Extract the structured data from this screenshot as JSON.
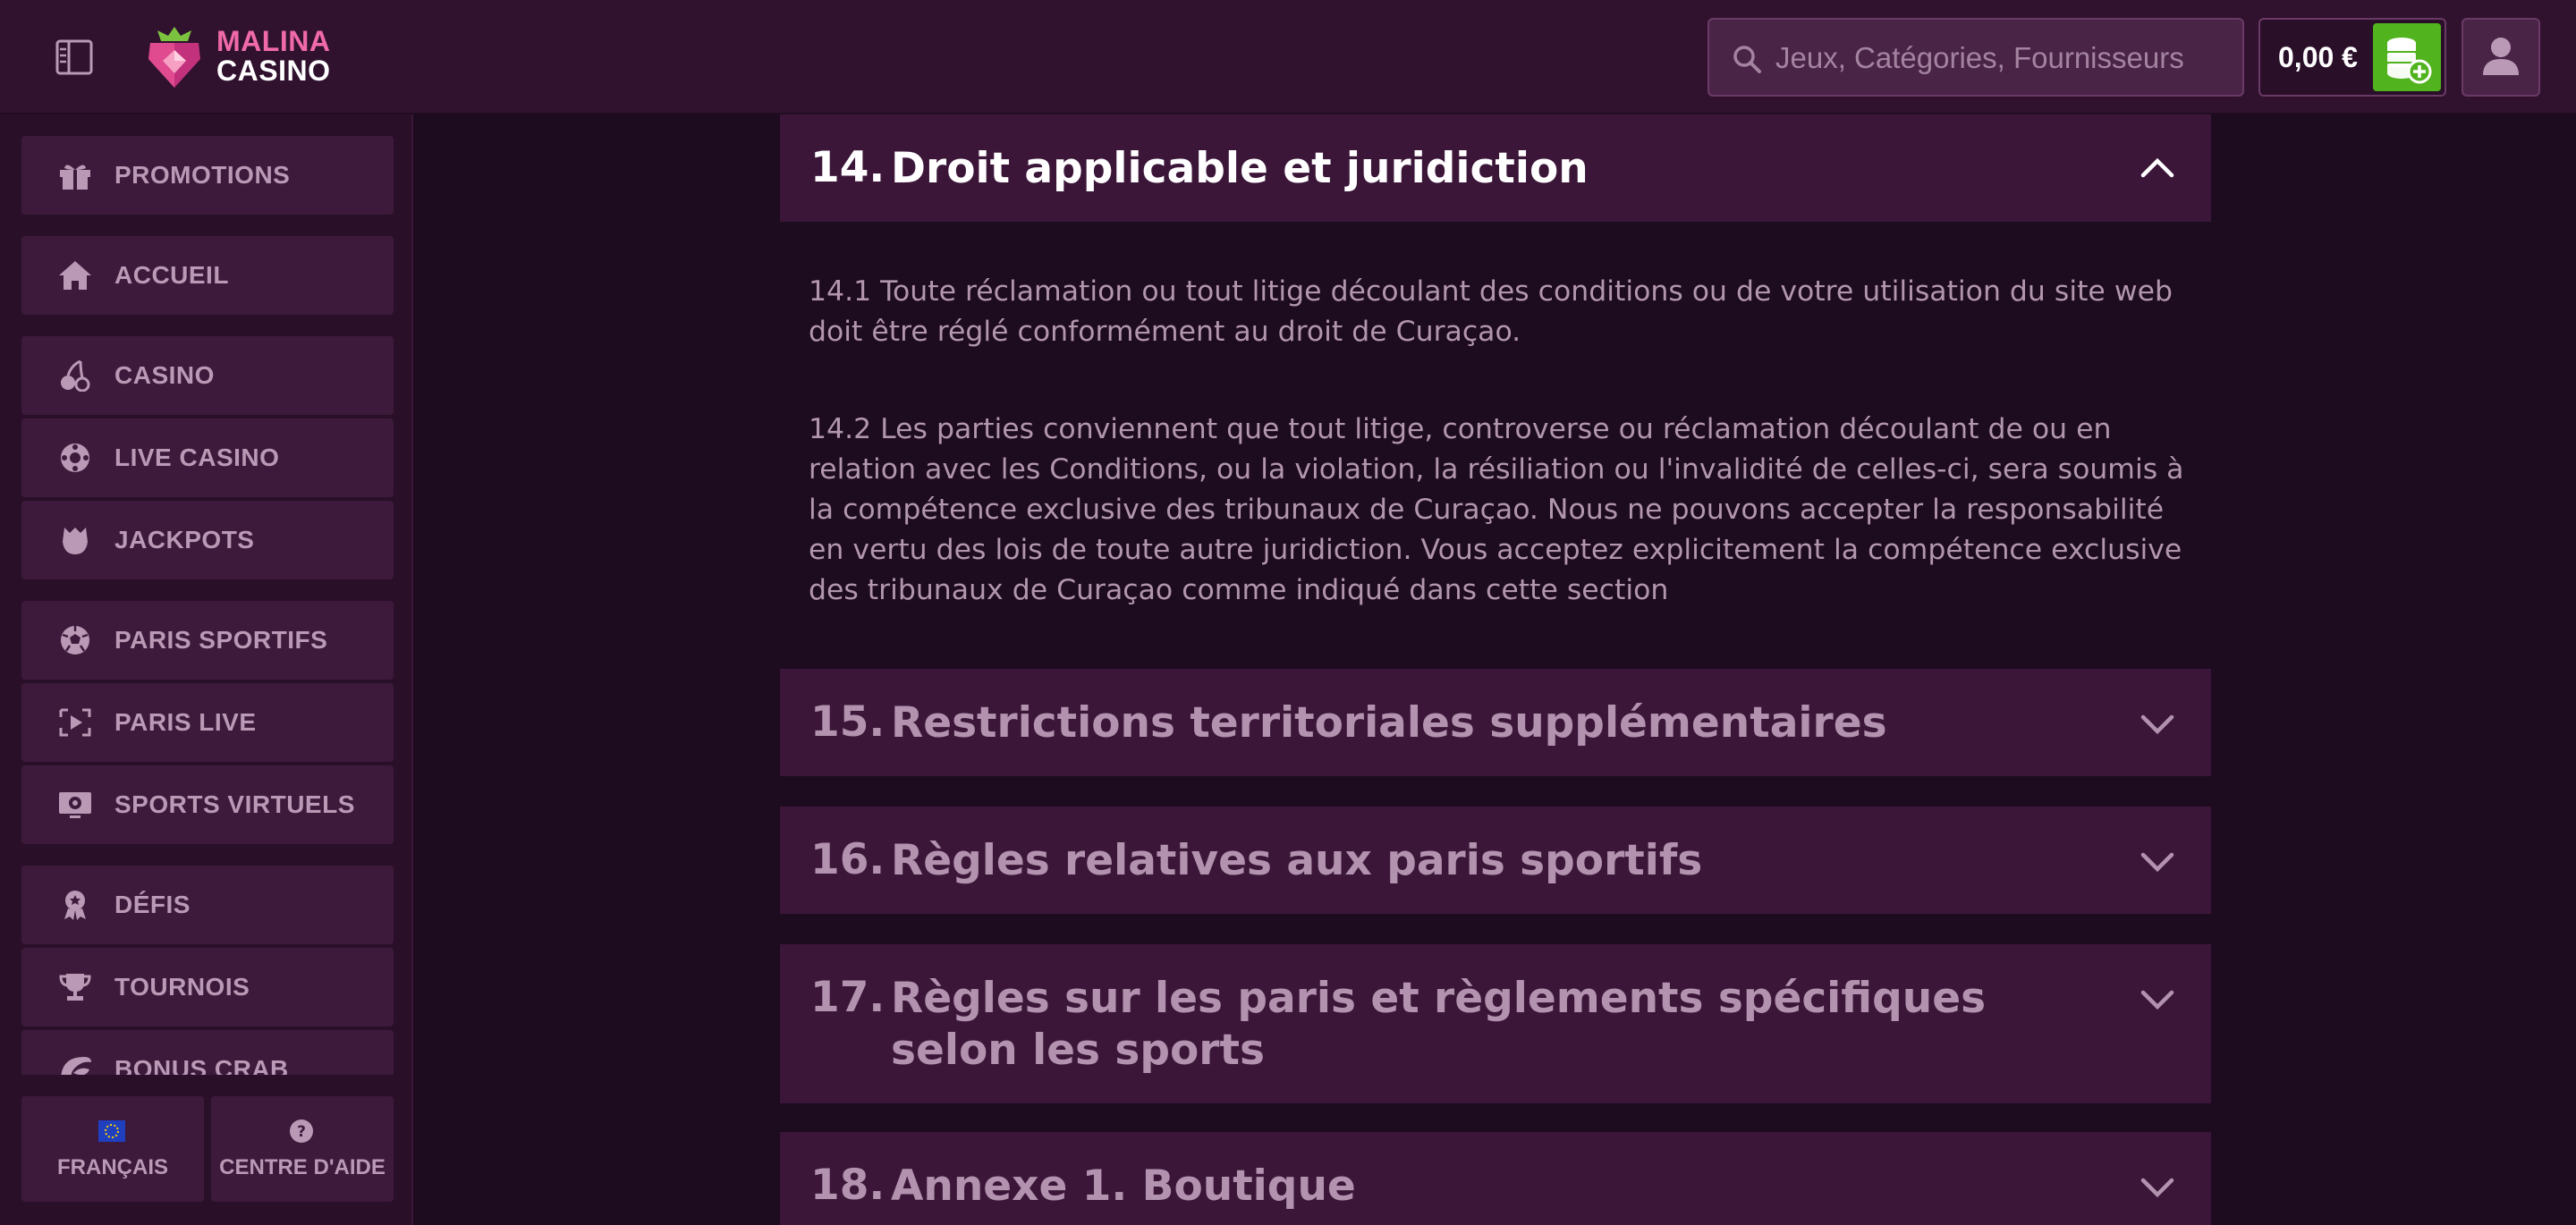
{
  "brand": {
    "line1": "MALINA",
    "line2": "CASINO"
  },
  "header": {
    "search_placeholder": "Jeux, Catégories, Fournisseurs",
    "balance": "0,00 €"
  },
  "sidebar": {
    "items": [
      {
        "label": "PROMOTIONS",
        "icon": "gift-icon"
      },
      {
        "label": "ACCUEIL",
        "icon": "home-icon"
      },
      {
        "label": "CASINO",
        "icon": "cherries-icon"
      },
      {
        "label": "LIVE CASINO",
        "icon": "roulette-icon"
      },
      {
        "label": "JACKPOTS",
        "icon": "jackpot-icon"
      },
      {
        "label": "PARIS SPORTIFS",
        "icon": "soccer-ball-icon"
      },
      {
        "label": "PARIS LIVE",
        "icon": "live-play-icon"
      },
      {
        "label": "SPORTS VIRTUELS",
        "icon": "virtual-sports-icon"
      },
      {
        "label": "DÉFIS",
        "icon": "award-badge-icon"
      },
      {
        "label": "TOURNOIS",
        "icon": "trophy-icon"
      },
      {
        "label": "BONUS CRAB",
        "icon": "crab-claw-icon"
      }
    ],
    "language": "FRANÇAIS",
    "help": "CENTRE D'AIDE"
  },
  "sections": [
    {
      "number": "14.",
      "title": "Droit applicable et juridiction",
      "expanded": true,
      "paragraphs": [
        "14.1 Toute réclamation ou tout litige découlant des conditions ou de votre utilisation du site web doit être réglé conformément au droit de Curaçao.",
        "14.2 Les parties conviennent que tout litige, controverse ou réclamation découlant de ou en relation avec les Conditions, ou la violation, la résiliation ou l'invalidité de celles-ci, sera soumis à la compétence exclusive des tribunaux de Curaçao. Nous ne pouvons accepter la responsabilité en vertu des lois de toute autre juridiction. Vous acceptez explicitement la compétence exclusive des tribunaux de Curaçao comme indiqué dans cette section"
      ]
    },
    {
      "number": "15.",
      "title": "Restrictions territoriales supplémentaires",
      "expanded": false
    },
    {
      "number": "16.",
      "title": "Règles relatives aux paris sportifs",
      "expanded": false
    },
    {
      "number": "17.",
      "title": "Règles sur les paris et règlements spécifiques selon les sports",
      "expanded": false
    },
    {
      "number": "18.",
      "title": "Annexe 1. Boutique",
      "expanded": false
    }
  ],
  "colors": {
    "header_bg": "#30122f",
    "page_bg": "#1d0b1f",
    "panel_bg": "#3b1639",
    "deposit_green": "#51b31d",
    "brand_pink": "#f06aa8"
  }
}
